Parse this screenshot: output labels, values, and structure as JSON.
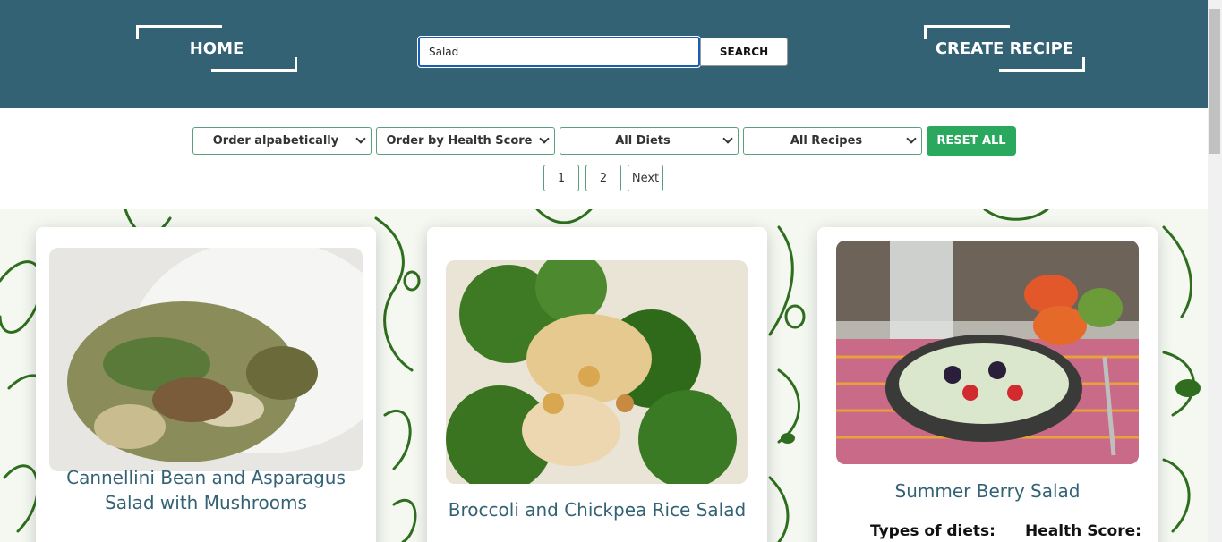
{
  "header": {
    "home_label": "HOME",
    "create_label": "CREATE RECIPE",
    "search_value": "Salad",
    "search_button": "SEARCH"
  },
  "filters": {
    "order_alpha": "Order alpabetically",
    "order_health": "Order by Health Score",
    "diets": "All Diets",
    "recipes": "All Recipes",
    "reset": "RESET ALL"
  },
  "pagination": {
    "pages": [
      "1",
      "2"
    ],
    "next": "Next"
  },
  "cards": [
    {
      "title": "Cannellini Bean and Asparagus Salad with Mushrooms"
    },
    {
      "title": "Broccoli and Chickpea Rice Salad"
    },
    {
      "title": "Summer Berry Salad",
      "diets_label": "Types of diets:",
      "health_label": "Health Score:"
    }
  ],
  "colors": {
    "header": "#346275",
    "accent_green": "#2aa85d",
    "title_blue": "#346275"
  }
}
